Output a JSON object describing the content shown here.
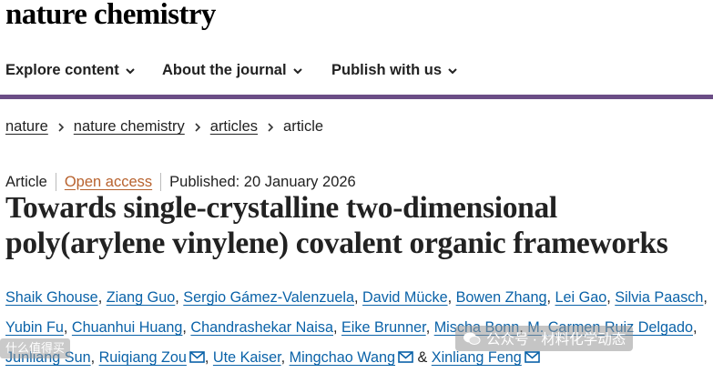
{
  "site": {
    "logo": "nature chemistry"
  },
  "nav": {
    "items": [
      {
        "label": "Explore content"
      },
      {
        "label": "About the journal"
      },
      {
        "label": "Publish with us"
      }
    ]
  },
  "breadcrumb": [
    "nature",
    "nature chemistry",
    "articles",
    "article"
  ],
  "article": {
    "type": "Article",
    "access": "Open access",
    "published": "Published: 20 January 2026",
    "title": "Towards single-crystalline two-dimensional poly(arylene vinylene) covalent organic frameworks",
    "authors": [
      "Shaik Ghouse",
      "Ziang Guo",
      "Sergio Gámez-Valenzuela",
      "David Mücke",
      "Bowen Zhang",
      "Lei Gao",
      "Silvia Paasch",
      "Yubin Fu",
      "Chuanhui Huang",
      "Chandrashekar Naisa",
      "Eike Brunner",
      "Mischa Bonn",
      "M. Carmen Ruiz Delgado",
      "Junliang Sun",
      "Ruiqiang Zou",
      "Ute Kaiser",
      "Mingchao Wang",
      "Xinliang Feng"
    ],
    "and": "&"
  },
  "watermark": {
    "text": "公众号 · 材料化学动态",
    "left_text": "什么值得买"
  },
  "colors": {
    "nav_underline": "#6b4d86",
    "author_link": "#0a62a8",
    "open_access": "#b8622e"
  }
}
